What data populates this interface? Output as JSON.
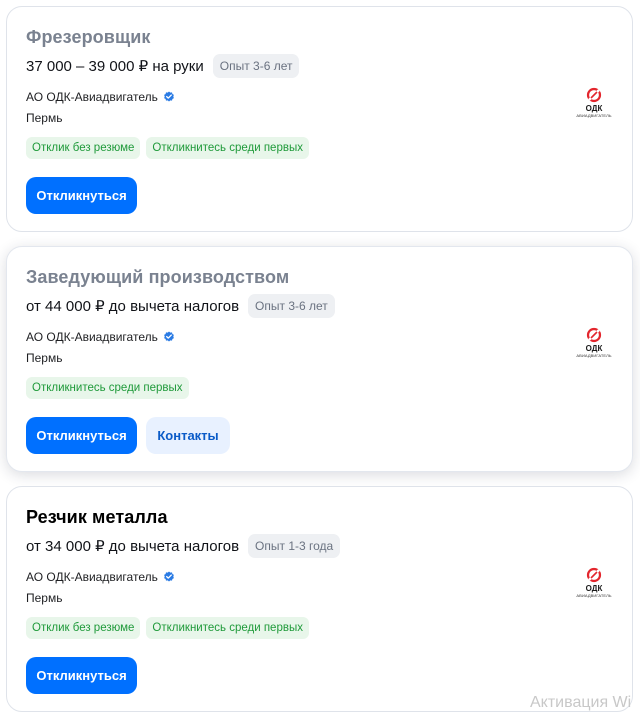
{
  "vacancies": [
    {
      "title": "Фрезеровщик",
      "salary": "37 000 – 39 000 ₽ на руки",
      "experience": "Опыт 3-6 лет",
      "company": "АО ОДК-Авиадвигатель",
      "city": "Пермь",
      "logo": {
        "name": "ОДК",
        "sub": "АВИАДВИГАТЕЛЬ"
      },
      "tags": [
        "Отклик без резюме",
        "Откликнитесь среди первых"
      ],
      "respond_label": "Откликнуться"
    },
    {
      "title": "Заведующий производством",
      "salary": "от 44 000 ₽ до вычета налогов",
      "experience": "Опыт 3-6 лет",
      "company": "АО ОДК-Авиадвигатель",
      "city": "Пермь",
      "logo": {
        "name": "ОДК",
        "sub": "АВИАДВИГАТЕЛЬ"
      },
      "tags": [
        "Откликнитесь среди первых"
      ],
      "respond_label": "Откликнуться",
      "contacts_label": "Контакты"
    },
    {
      "title": "Резчик металла",
      "salary": "от 34 000 ₽ до вычета налогов",
      "experience": "Опыт 1-3 года",
      "company": "АО ОДК-Авиадвигатель",
      "city": "Пермь",
      "logo": {
        "name": "ОДК",
        "sub": "АВИАДВИГАТЕЛЬ"
      },
      "tags": [
        "Отклик без резюме",
        "Откликнитесь среди первых"
      ],
      "respond_label": "Откликнуться"
    }
  ],
  "watermark": "Активация Wi",
  "icons": {
    "verified": "verified-check-icon",
    "logo": "odk-logo-icon"
  },
  "colors": {
    "primary": "#0070ff",
    "verified": "#2a7be4",
    "tag_bg": "#e8f6ea",
    "tag_text": "#1f9a3a",
    "logo_red": "#e3262d"
  }
}
